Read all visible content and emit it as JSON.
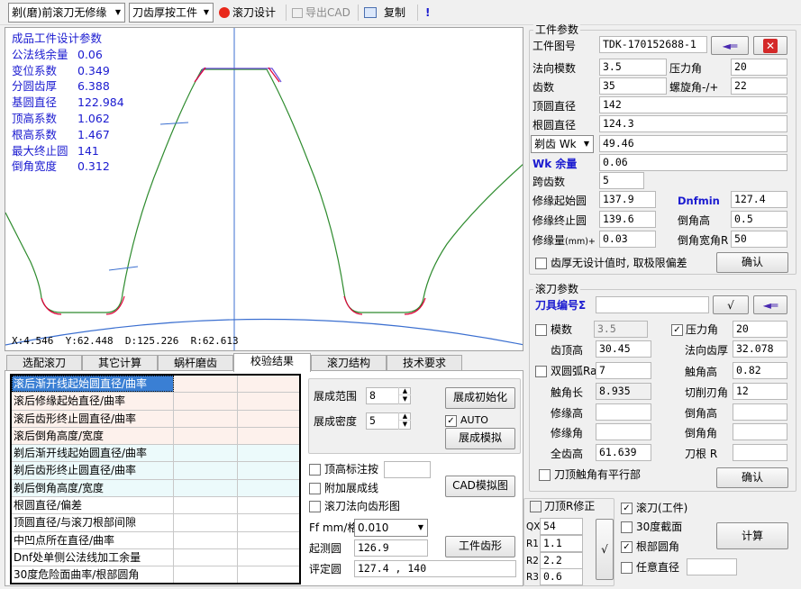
{
  "toolbar": {
    "mode_select": "剃(磨)前滚刀无修缘",
    "thickness_select": "刀齿厚按工件",
    "hob_design": "滚刀设计",
    "export_cad": "导出CAD",
    "copy": "复制",
    "info": "!"
  },
  "plot": {
    "params_title": "成品工件设计参数",
    "params": [
      {
        "k": "公法线余量",
        "v": "0.06"
      },
      {
        "k": "变位系数",
        "v": "0.349"
      },
      {
        "k": "分圆齿厚",
        "v": "6.388"
      },
      {
        "k": "基圆直径",
        "v": "122.984"
      },
      {
        "k": "顶高系数",
        "v": "1.062"
      },
      {
        "k": "根高系数",
        "v": "1.467"
      },
      {
        "k": "最大终止圆",
        "v": "141"
      },
      {
        "k": "倒角宽度",
        "v": "0.312"
      }
    ],
    "coords": "X:4.546  Y:62.448  D:125.226  R:62.613"
  },
  "tabs": [
    "选配滚刀",
    "其它计算",
    "蜗杆磨齿",
    "校验结果",
    "滚刀结构",
    "技术要求"
  ],
  "grid_rows": [
    "滚后渐开线起始圆直径/曲率",
    "滚后修缘起始直径/曲率",
    "滚后齿形终止圆直径/曲率",
    "滚后倒角高度/宽度",
    "剃后渐开线起始圆直径/曲率",
    "剃后齿形终止圆直径/曲率",
    "剃后倒角高度/宽度",
    "根圆直径/偏差",
    "顶圆直径/与滚刀根部间隙",
    "中凹点所在直径/曲率",
    "Dnf处单侧公法线加工余量",
    "30度危险面曲率/根部圆角"
  ],
  "check_panel": {
    "range_label": "展成范围",
    "range_value": "8",
    "density_label": "展成密度",
    "density_value": "5",
    "init_button": "展成初始化",
    "auto_label": "AUTO",
    "simulate_button": "展成模拟",
    "tip_mark": "顶高标注按",
    "extra_line": "附加展成线",
    "hob_profile": "滚刀法向齿形图",
    "cad_button": "CAD模拟图",
    "ff_label": "Ff mm/格",
    "ff_value": "0.010",
    "start_label": "起测圆",
    "start_value": "126.9",
    "workpiece_button": "工件齿形",
    "eval_label": "评定圆",
    "eval_value": "127.4 , 140"
  },
  "workpiece": {
    "title": "工件参数",
    "drawing_no_label": "工件图号",
    "drawing_no": "TDK-170152688-1",
    "normal_module_label": "法向模数",
    "normal_module": "3.5",
    "pressure_angle_label": "压力角",
    "pressure_angle": "20",
    "teeth_label": "齿数",
    "teeth": "35",
    "helix_label": "螺旋角-/+",
    "helix": "22",
    "tip_dia_label": "顶圆直径",
    "tip_dia": "142",
    "root_dia_label": "根圆直径",
    "root_dia": "124.3",
    "wk_select": "剃齿 Wk",
    "wk_value": "49.46",
    "wk_allow_label": "Wk 余量",
    "wk_allow": "0.06",
    "span_teeth_label": "跨齿数",
    "span_teeth": "5",
    "mod_start_label": "修缘起始圆",
    "mod_start": "137.9",
    "dnfmin_label": "Dnfmin",
    "dnfmin": "127.4",
    "mod_end_label": "修缘终止圆",
    "mod_end": "139.6",
    "chamfer_h_label": "倒角高",
    "chamfer_h": "0.5",
    "mod_amount_label": "修缘量",
    "mod_amount_unit": "(mm)+",
    "mod_amount": "0.03",
    "chamfer_w_label": "倒角宽角R",
    "chamfer_w": "50",
    "limit_check": "齿厚无设计值时, 取极限偏差",
    "confirm": "确认"
  },
  "hob": {
    "title": "滚刀参数",
    "tool_no_label": "刀具编号Σ",
    "tool_no": "",
    "module_label": "模数",
    "module": "3.5",
    "pa_label": "压力角",
    "pa": "20",
    "addendum_label": "齿顶高",
    "addendum": "30.45",
    "normal_thick_label": "法向齿厚",
    "normal_thick": "32.078",
    "double_arc_label": "双圆弧Ra",
    "double_arc": "7",
    "touch_height_label": "触角高",
    "touch_height": "0.82",
    "touch_length_label": "触角长",
    "touch_length": "8.935",
    "cut_angle_label": "切削刃角",
    "cut_angle": "12",
    "edge_h_label": "修缘高",
    "edge_h": "",
    "chamfer_high_label": "倒角高",
    "chamfer_high": "",
    "edge_a_label": "修缘角",
    "edge_a": "",
    "chamfer_angle_label": "倒角角",
    "chamfer_angle": "",
    "full_h_label": "全齿高",
    "full_h": "61.639",
    "root_r_label": "刀根 R",
    "root_r": "",
    "parallel_label": "刀顶触角有平行部",
    "confirm": "确认"
  },
  "bottom": {
    "r_corr_label": "刀顶R修正",
    "qx_label": "QX",
    "qx": "54",
    "r1_label": "R1",
    "r1": "1.1",
    "r2_label": "R2",
    "r2": "2.2",
    "r3_label": "R3",
    "r3": "0.6",
    "hob_work_label": "滚刀(工件)",
    "deg30_label": "30度截面",
    "root_fillet_label": "根部圆角",
    "any_dia_label": "任意直径",
    "compute_button": "计算"
  },
  "colors": {
    "blue_text": "#1a1ad0",
    "curve_green": "#2e8b2e",
    "curve_red": "#e0003a",
    "axis_blue": "#3b6fd0"
  }
}
